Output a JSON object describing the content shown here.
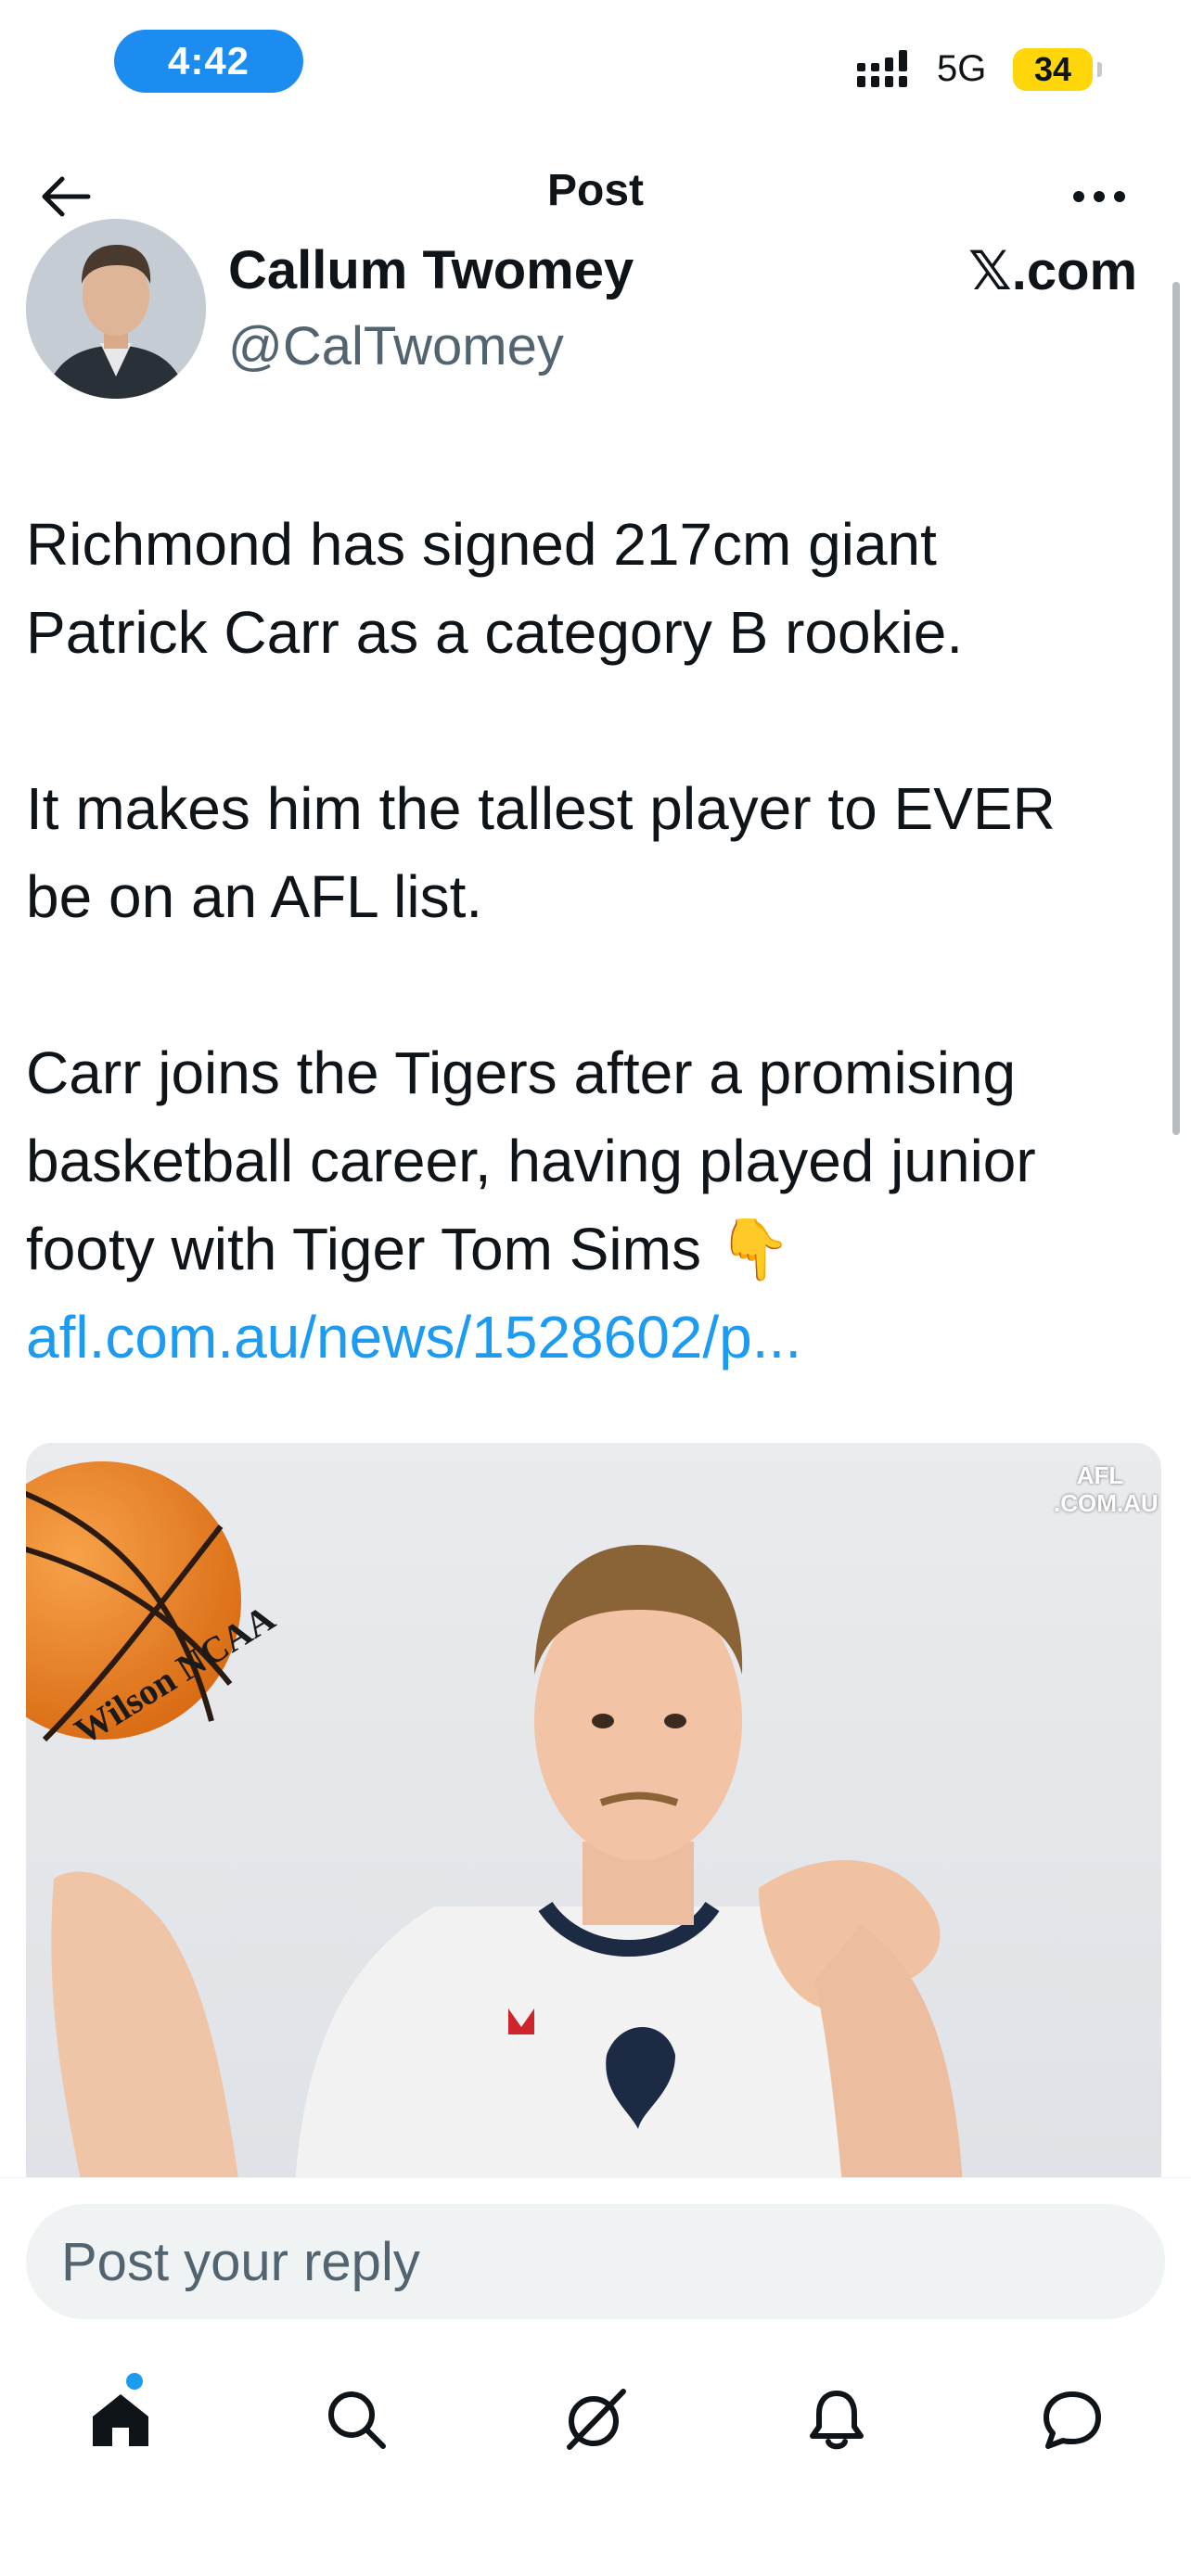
{
  "status_bar": {
    "time": "4:42",
    "network": "5G",
    "battery": "34"
  },
  "header": {
    "title": "Post",
    "back_icon": "arrow-left-icon",
    "more_icon": "more-horizontal-icon"
  },
  "post": {
    "author": {
      "display_name": "Callum Twomey",
      "handle": "@CalTwomey"
    },
    "source_badge": "𝕏.com",
    "paragraphs": [
      [
        "Richmond has signed 217cm giant",
        "Patrick Carr as a category B rookie."
      ],
      [
        "It makes him the tallest player to EVER",
        "be on an AFL list."
      ],
      [
        "Carr joins the Tigers after a promising",
        "basketball career, having played junior",
        "footy with Tiger Tom Sims 👇"
      ]
    ],
    "link": "afl.com.au/news/1528602/p...",
    "media": {
      "watermark_line1": "AFL",
      "watermark_line2": ".COM.AU",
      "ball_text": "Wilson NCAA"
    }
  },
  "reply": {
    "placeholder": "Post your reply"
  },
  "tab_bar": {
    "items": [
      {
        "name": "home",
        "icon": "home-icon",
        "has_notification_dot": true
      },
      {
        "name": "search",
        "icon": "search-icon"
      },
      {
        "name": "grok",
        "icon": "grok-icon"
      },
      {
        "name": "notifications",
        "icon": "bell-icon"
      },
      {
        "name": "messages",
        "icon": "message-icon"
      }
    ]
  },
  "colors": {
    "accent": "#1d9bf0",
    "time_pill": "#1d8cf0",
    "battery": "#ffd60a",
    "secondary_text": "#536471"
  }
}
